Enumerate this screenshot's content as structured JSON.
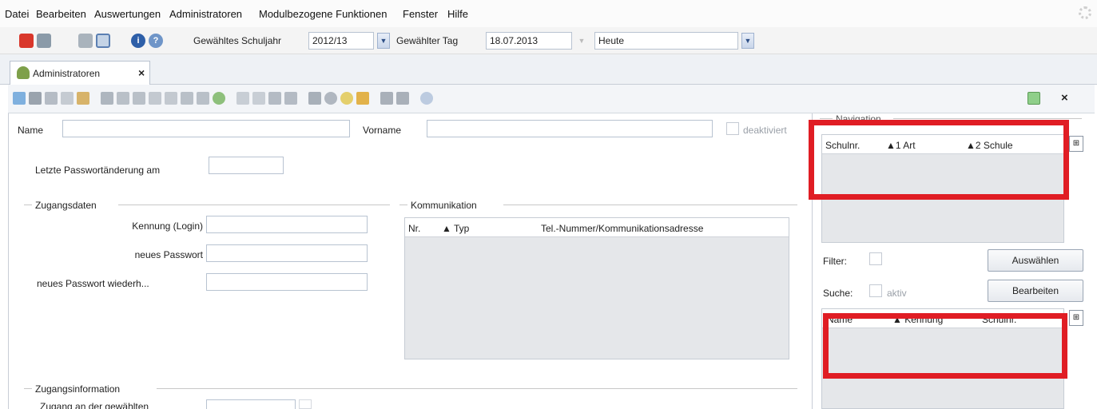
{
  "menu": [
    "Datei",
    "Bearbeiten",
    "Auswertungen",
    "Administratoren",
    "Modulbezogene Funktionen",
    "Fenster",
    "Hilfe"
  ],
  "toolbar": {
    "schuljahr_label": "Gewähltes Schuljahr",
    "schuljahr_value": "2012/13",
    "tag_label": "Gewählter Tag",
    "tag_value": "18.07.2013",
    "heute_value": "Heute"
  },
  "tab": {
    "label": "Administratoren",
    "close": "×"
  },
  "form": {
    "name_label": "Name",
    "vorname_label": "Vorname",
    "deaktiviert_label": "deaktiviert",
    "passwort_change_label": "Letzte Passwortänderung am",
    "zugangsdaten_title": "Zugangsdaten",
    "kennung_label": "Kennung (Login)",
    "neues_passwort_label": "neues Passwort",
    "neues_passwort_wdh_label": "neues Passwort wiederh...",
    "zugangsinfo_title": "Zugangsinformation",
    "zugang_label": "Zugang an der gewählten"
  },
  "kommunikation": {
    "title": "Kommunikation",
    "columns": [
      "Nr.",
      "▲ Typ",
      "Tel.-Nummer/Kommunikationsadresse"
    ]
  },
  "navigation": {
    "title": "Navigation",
    "close": "×",
    "school_columns": [
      "Schulnr.",
      "▲1 Art",
      "▲2 Schule"
    ],
    "filter_label": "Filter:",
    "suche_label": "Suche:",
    "aktiv_label": "aktiv",
    "auswaehlen_button": "Auswählen",
    "bearbeiten_button": "Bearbeiten",
    "admin_columns": [
      "Name",
      "▲ Kennung",
      "Schulnr."
    ]
  },
  "colors": {
    "highlight": "#e01d24",
    "accent": "#2e5fa8"
  }
}
